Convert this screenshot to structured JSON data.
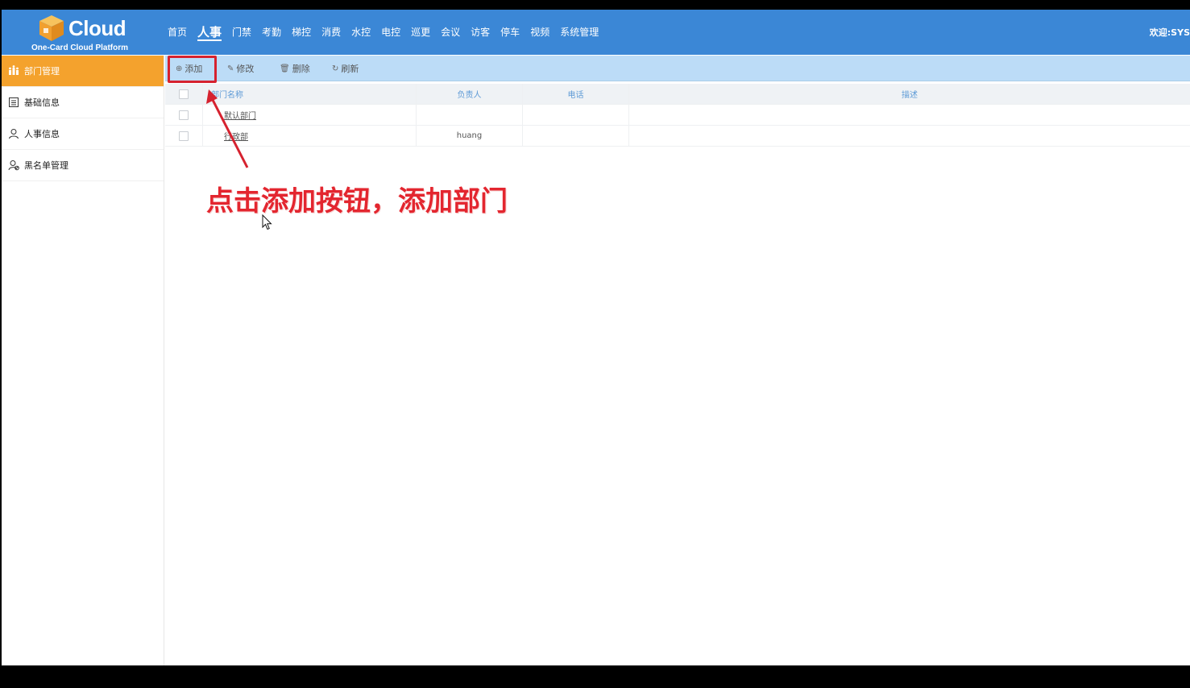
{
  "header": {
    "logo_word": "Cloud",
    "logo_sub": "One-Card Cloud Platform",
    "nav": [
      "首页",
      "人事",
      "门禁",
      "考勤",
      "梯控",
      "消费",
      "水控",
      "电控",
      "巡更",
      "会议",
      "访客",
      "停车",
      "视频",
      "系统管理"
    ],
    "active_nav": "人事",
    "welcome": "欢迎:SYS"
  },
  "sidebar": {
    "items": [
      {
        "label": "部门管理",
        "icon": "group-icon",
        "active": true
      },
      {
        "label": "基础信息",
        "icon": "list-icon",
        "active": false
      },
      {
        "label": "人事信息",
        "icon": "person-icon",
        "active": false
      },
      {
        "label": "黑名单管理",
        "icon": "blacklist-icon",
        "active": false
      }
    ]
  },
  "toolbar": {
    "add": "添加",
    "edit": "修改",
    "delete": "删除",
    "refresh": "刷新"
  },
  "table": {
    "headers": {
      "name": "部门名称",
      "owner": "负责人",
      "phone": "电话",
      "desc": "描述"
    },
    "rows": [
      {
        "name": "默认部门",
        "owner": "",
        "phone": "",
        "desc": ""
      },
      {
        "name": "行政部",
        "owner": "huang",
        "phone": "",
        "desc": ""
      }
    ]
  },
  "annotation": {
    "text": "点击添加按钮，添加部门"
  },
  "colors": {
    "header": "#3b87d6",
    "sidebar_active": "#f4a22d",
    "toolbar": "#bcdcf7",
    "annotation": "#e3262f"
  }
}
